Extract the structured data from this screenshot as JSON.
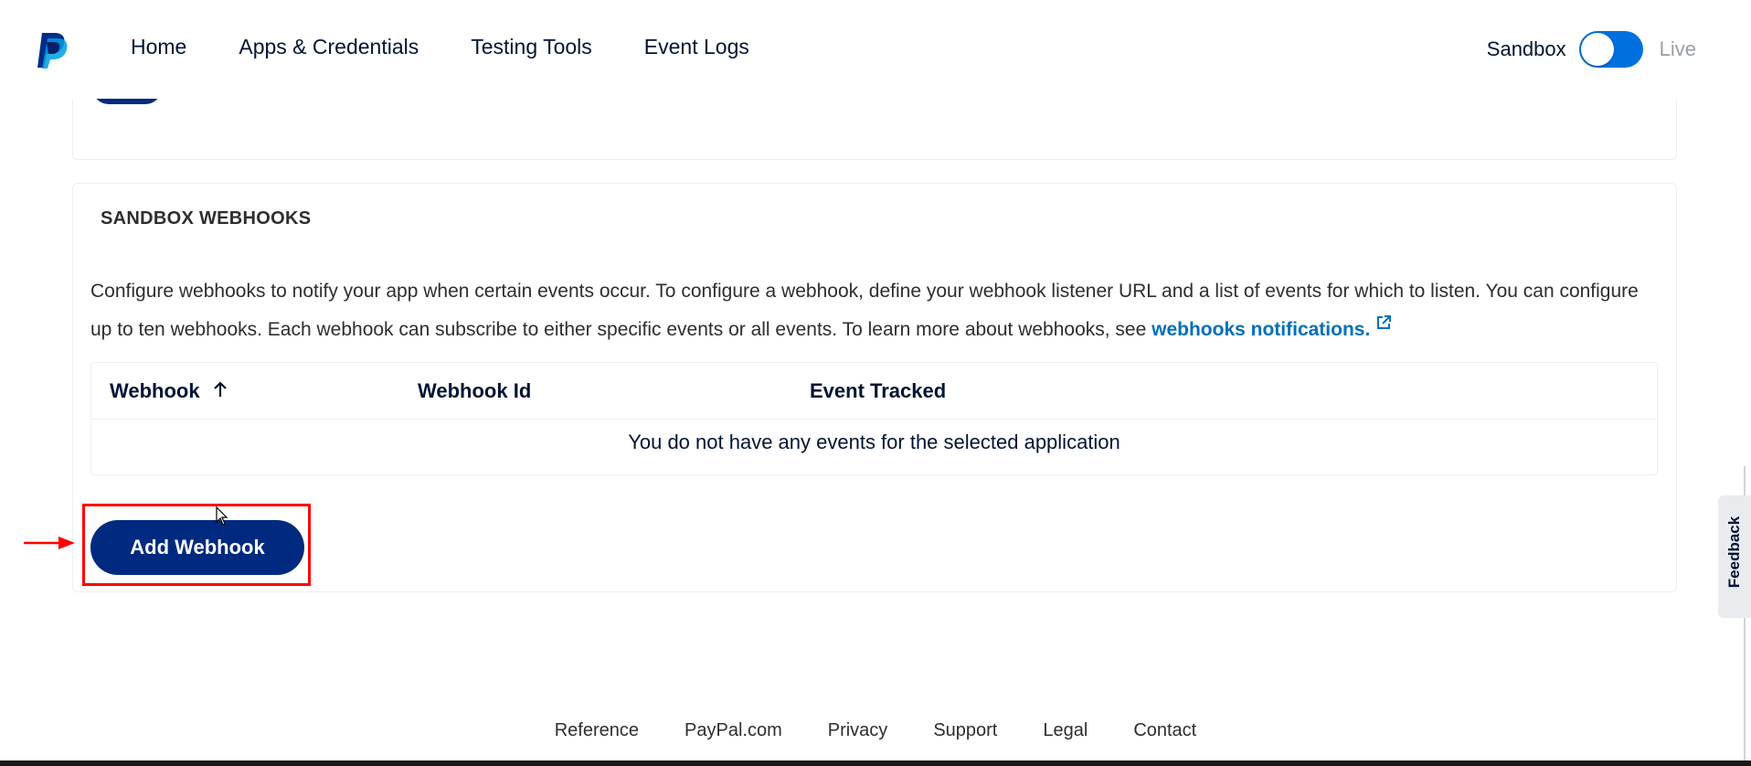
{
  "nav": {
    "items": [
      "Home",
      "Apps & Credentials",
      "Testing Tools",
      "Event Logs"
    ]
  },
  "environment": {
    "sandbox_label": "Sandbox",
    "live_label": "Live",
    "active": "Sandbox"
  },
  "webhooks": {
    "title": "SANDBOX WEBHOOKS",
    "description": "Configure webhooks to notify your app when certain events occur. To configure a webhook, define your webhook listener URL and a list of events for which to listen. You can configure up to ten webhooks. Each webhook can subscribe to either specific events or all events. To learn more about webhooks, see ",
    "link_text": "webhooks notifications.",
    "table": {
      "columns": [
        "Webhook",
        "Webhook Id",
        "Event Tracked"
      ],
      "empty_message": "You do not have any events for the selected application"
    },
    "add_button": "Add Webhook"
  },
  "feedback_label": "Feedback",
  "footer": {
    "links": [
      "Reference",
      "PayPal.com",
      "Privacy",
      "Support",
      "Legal",
      "Contact"
    ]
  },
  "colors": {
    "brand_navy": "#002a7f",
    "toggle_blue": "#0070e0",
    "link_blue": "#0070ba",
    "highlight_red": "#ff0000"
  },
  "icons": {
    "logo": "paypal-logo",
    "sort": "arrow-up-icon",
    "external": "external-link-icon"
  }
}
